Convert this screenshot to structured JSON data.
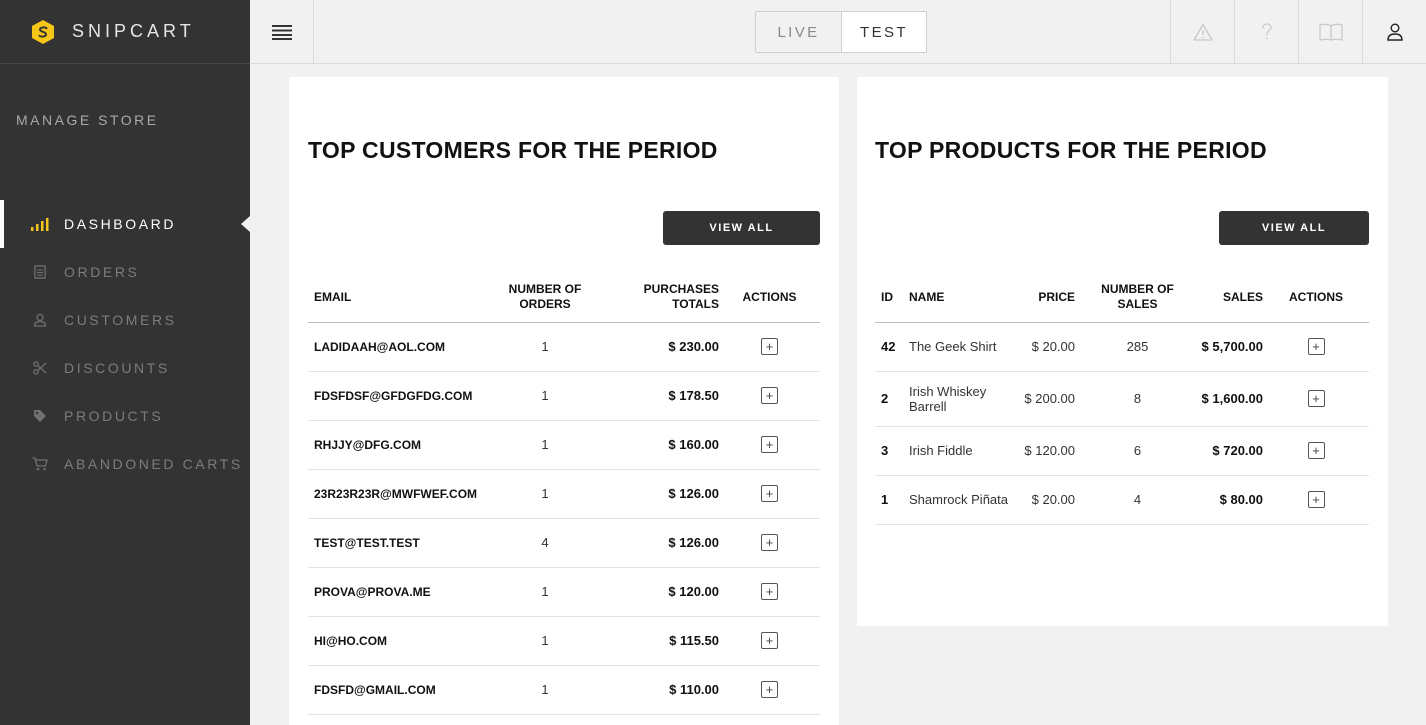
{
  "brand": {
    "name": "SNIPCART",
    "logo_color": "#f5c518"
  },
  "sidebar": {
    "section_title": "MANAGE STORE",
    "items": [
      {
        "label": "DASHBOARD",
        "icon": "bar-chart-icon"
      },
      {
        "label": "ORDERS",
        "icon": "receipt-icon"
      },
      {
        "label": "CUSTOMERS",
        "icon": "user-icon"
      },
      {
        "label": "DISCOUNTS",
        "icon": "scissors-icon"
      },
      {
        "label": "PRODUCTS",
        "icon": "tag-icon"
      },
      {
        "label": "ABANDONED CARTS",
        "icon": "cart-icon"
      }
    ],
    "active": "DASHBOARD"
  },
  "topbar": {
    "mode_options": [
      "LIVE",
      "TEST"
    ],
    "selected_mode": "TEST",
    "icons": [
      "warning-icon",
      "help-icon",
      "docs-book-icon",
      "account-icon"
    ]
  },
  "customers_panel": {
    "title": "TOP CUSTOMERS FOR THE PERIOD",
    "view_all": "VIEW ALL",
    "columns": {
      "email": "EMAIL",
      "orders_line1": "NUMBER OF",
      "orders_line2": "ORDERS",
      "totals_line1": "PURCHASES",
      "totals_line2": "TOTALS",
      "actions": "ACTIONS"
    },
    "rows": [
      {
        "email": "LADIDAAH@AOL.COM",
        "orders": "1",
        "total": "$ 230.00"
      },
      {
        "email": "FDSFDSF@GFDGFDG.COM",
        "orders": "1",
        "total": "$ 178.50"
      },
      {
        "email": "RHJJY@DFG.COM",
        "orders": "1",
        "total": "$ 160.00"
      },
      {
        "email": "23R23R23R@MWFWEF.COM",
        "orders": "1",
        "total": "$ 126.00"
      },
      {
        "email": "TEST@TEST.TEST",
        "orders": "4",
        "total": "$ 126.00"
      },
      {
        "email": "PROVA@PROVA.ME",
        "orders": "1",
        "total": "$ 120.00"
      },
      {
        "email": "HI@HO.COM",
        "orders": "1",
        "total": "$ 115.50"
      },
      {
        "email": "FDSFD@GMAIL.COM",
        "orders": "1",
        "total": "$ 110.00"
      }
    ]
  },
  "products_panel": {
    "title": "TOP PRODUCTS FOR THE PERIOD",
    "view_all": "VIEW ALL",
    "columns": {
      "id": "ID",
      "name": "NAME",
      "price": "PRICE",
      "sales_count_line1": "NUMBER OF",
      "sales_count_line2": "SALES",
      "sales": "SALES",
      "actions": "ACTIONS"
    },
    "rows": [
      {
        "id": "42",
        "name_line1": "The Geek Shirt",
        "name_line2": "",
        "price": "$ 20.00",
        "count": "285",
        "sales": "$ 5,700.00"
      },
      {
        "id": "2",
        "name_line1": "Irish Whiskey",
        "name_line2": "Barrell",
        "price": "$ 200.00",
        "count": "8",
        "sales": "$ 1,600.00"
      },
      {
        "id": "3",
        "name_line1": "Irish Fiddle",
        "name_line2": "",
        "price": "$ 120.00",
        "count": "6",
        "sales": "$ 720.00"
      },
      {
        "id": "1",
        "name_line1": "Shamrock Piñata",
        "name_line2": "",
        "price": "$ 20.00",
        "count": "4",
        "sales": "$ 80.00"
      }
    ]
  },
  "action_glyph": "+"
}
